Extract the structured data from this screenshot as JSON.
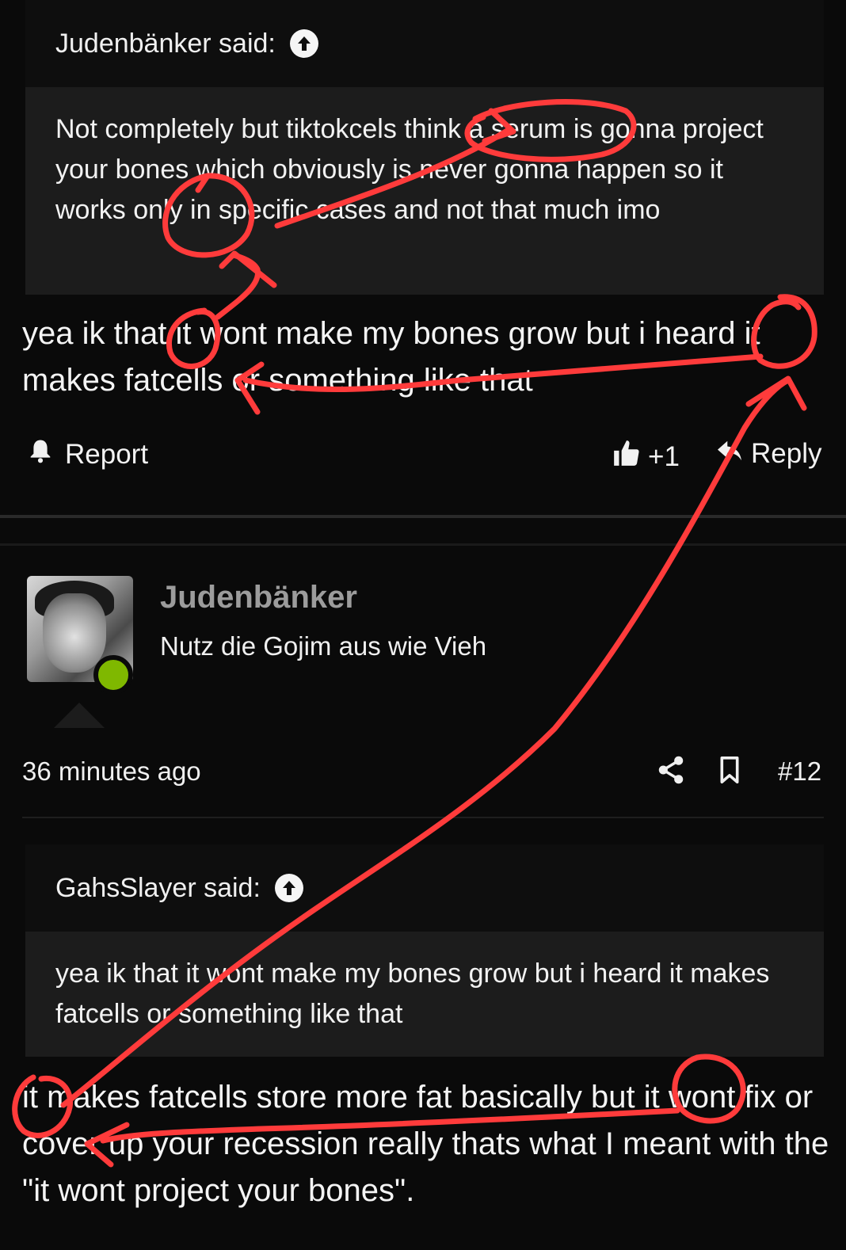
{
  "post1": {
    "quote": {
      "author_said": "Judenbänker said:",
      "text": "Not completely but tiktokcels think a serum is gonna project your bones which obviously is never gonna happen so it works only in specific cases and not that much imo"
    },
    "reply_text": "yea ik that it wont make my bones grow but i heard it makes fatcells or something like that",
    "actions": {
      "report_label": "Report",
      "like_count": "+1",
      "reply_label": "Reply"
    }
  },
  "post2": {
    "user": {
      "name": "Judenbänker",
      "title": "Nutz die Gojim aus wie Vieh",
      "status_color": "#7fb800"
    },
    "meta": {
      "time": "36 minutes ago",
      "post_number": "#12"
    },
    "quote": {
      "author_said": "GahsSlayer said:",
      "text": "yea ik that it wont make my bones grow but i heard it makes fatcells or something like that"
    },
    "reply_text": "it makes fatcells store more fat basically but it wont fix or cover up your recession really thats what I meant with the \"it wont project your bones\"."
  },
  "colors": {
    "background": "#0a0a0a",
    "quote_bg": "#1c1c1c",
    "annotation": "#ff3b3b",
    "username": "#9c9c9c"
  },
  "icons": [
    "arrow-up-circle-icon",
    "bell-icon",
    "thumbs-up-icon",
    "reply-icon",
    "share-icon",
    "bookmark-icon"
  ]
}
